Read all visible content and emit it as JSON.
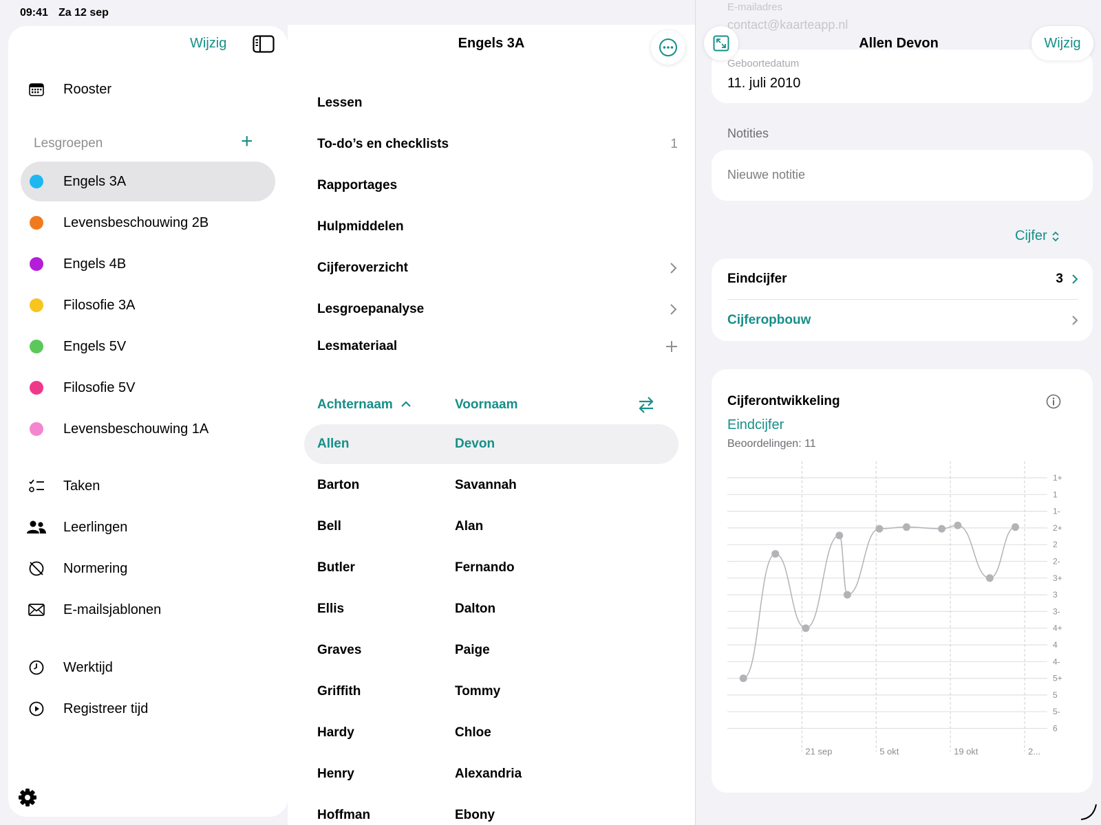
{
  "status": {
    "time": "09:41",
    "date": "Za 12 sep"
  },
  "sidebar": {
    "edit_label": "Wijzig",
    "schedule": "Rooster",
    "section": "Lesgroepen",
    "groups": [
      {
        "label": "Engels 3A",
        "color": "#1fb7f1"
      },
      {
        "label": "Levensbeschouwing 2B",
        "color": "#f07b1e"
      },
      {
        "label": "Engels 4B",
        "color": "#b51ed8"
      },
      {
        "label": "Filosofie 3A",
        "color": "#f7c51e"
      },
      {
        "label": "Engels 5V",
        "color": "#5ac95a"
      },
      {
        "label": "Filosofie 5V",
        "color": "#f0388a"
      },
      {
        "label": "Levensbeschouwing 1A",
        "color": "#f486d0"
      }
    ],
    "tools": [
      "Taken",
      "Leerlingen",
      "Normering",
      "E-mailsjablonen"
    ],
    "time_items": [
      "Werktijd",
      "Registreer tijd"
    ]
  },
  "middle": {
    "title": "Engels 3A",
    "menu": [
      {
        "label": "Lessen",
        "right": ""
      },
      {
        "label": "To-do’s en checklists",
        "right": "1"
      },
      {
        "label": "Rapportages",
        "right": ""
      },
      {
        "label": "Hulpmiddelen",
        "right": ""
      },
      {
        "label": "Cijferoverzicht",
        "right": "chevron"
      },
      {
        "label": "Lesgroepanalyse",
        "right": "chevron"
      },
      {
        "label": "Lesmateriaal",
        "right": "plus"
      }
    ],
    "sort_last": "Achternaam",
    "sort_first": "Voornaam",
    "students": [
      {
        "last": "Allen",
        "first": "Devon"
      },
      {
        "last": "Barton",
        "first": "Savannah"
      },
      {
        "last": "Bell",
        "first": "Alan"
      },
      {
        "last": "Butler",
        "first": "Fernando"
      },
      {
        "last": "Ellis",
        "first": "Dalton"
      },
      {
        "last": "Graves",
        "first": "Paige"
      },
      {
        "last": "Griffith",
        "first": "Tommy"
      },
      {
        "last": "Hardy",
        "first": "Chloe"
      },
      {
        "last": "Henry",
        "first": "Alexandria"
      },
      {
        "last": "Hoffman",
        "first": "Ebony"
      }
    ]
  },
  "detail": {
    "title": "Allen Devon",
    "edit_label": "Wijzig",
    "ghost_label": "E-mailadres",
    "ghost_value": "contact@kaarteapp.nl",
    "birth_label": "Geboortedatum",
    "birth_value": "11. juli 2010",
    "notes_label": "Notities",
    "new_note": "Nieuwe notitie",
    "grade_toggle": "Cijfer",
    "final_label": "Eindcijfer",
    "final_value": "3",
    "breakdown_label": "Cijferopbouw",
    "chart_title": "Cijferontwikkeling",
    "chart_subtitle": "Eindcijfer",
    "chart_count": "Beoordelingen: 11"
  },
  "chart_data": {
    "type": "line",
    "y_ticks": [
      "1+",
      "1",
      "1-",
      "2+",
      "2",
      "2-",
      "3+",
      "3",
      "3-",
      "4+",
      "4",
      "4-",
      "5+",
      "5",
      "5-",
      "6"
    ],
    "x_ticks": [
      "21 sep",
      "5 okt",
      "19 okt",
      "2..."
    ],
    "grid": true,
    "legend": "none",
    "points": [
      {
        "x": 0.05,
        "y": "5+"
      },
      {
        "x": 0.15,
        "y": 4.55
      },
      {
        "x": 0.245,
        "y": "4+"
      },
      {
        "x": 0.35,
        "y": 3.45
      },
      {
        "x": 0.375,
        "y": "3"
      },
      {
        "x": 0.475,
        "y": 3.05
      },
      {
        "x": 0.56,
        "y": 2.95
      },
      {
        "x": 0.67,
        "y": 3.05
      },
      {
        "x": 0.72,
        "y": 2.85
      },
      {
        "x": 0.82,
        "y": "3+"
      },
      {
        "x": 0.9,
        "y": 2.95
      }
    ]
  }
}
